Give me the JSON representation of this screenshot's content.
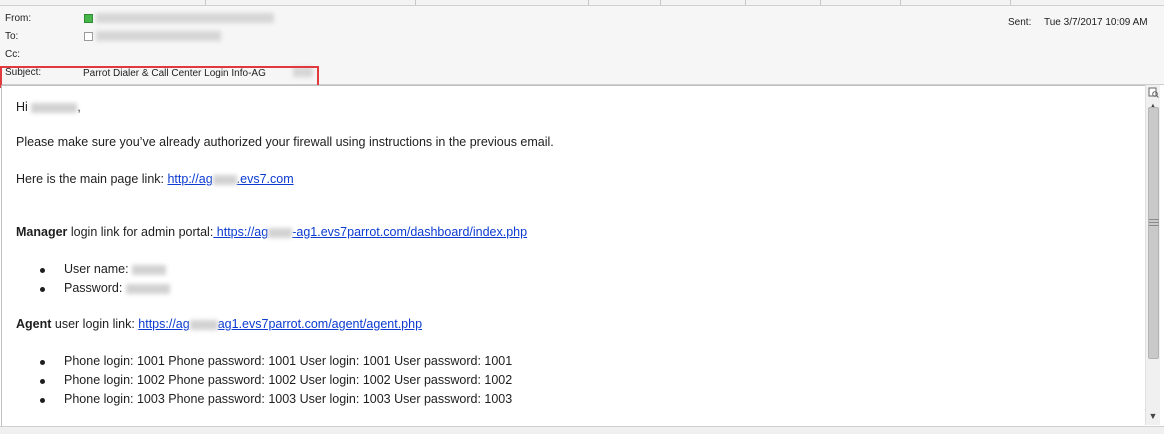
{
  "header": {
    "from_label": "From:",
    "to_label": "To:",
    "cc_label": "Cc:",
    "subject_label": "Subject:",
    "subject_value": "Parrot Dialer & Call Center Login Info-AG",
    "sent_label": "Sent:",
    "sent_value": "Tue 3/7/2017 10:09 AM"
  },
  "body": {
    "greeting": "Hi",
    "greeting_punct": ",",
    "line1": "Please make sure you’ve already authorized your firewall using instructions in the previous email.",
    "main_link_prefix": "Here is the main page link: ",
    "main_link_a": "http://ag",
    "main_link_b": ".evs7.com",
    "manager_bold": "Manager",
    "manager_rest": " login link for admin portal:",
    "manager_link_a": " https://ag",
    "manager_link_b": "-ag1.evs7parrot.com/dashboard/index.php",
    "manager_items": [
      "User name: ",
      "Password: "
    ],
    "agent_bold": "Agent",
    "agent_rest": " user login link: ",
    "agent_link_a": "https://ag",
    "agent_link_b": "ag1.evs7parrot.com/agent/agent.php",
    "phone_items": [
      "Phone login: 1001  Phone password: 1001  User login: 1001  User password: 1001",
      "Phone login: 1002  Phone password: 1002  User login: 1002  User password: 1002",
      "Phone login: 1003  Phone password: 1003  User login: 1003  User password: 1003"
    ]
  },
  "scrollbar": {
    "up_arrow": "▲",
    "down_arrow": "▼",
    "scroll_position": 0.0
  },
  "colors": {
    "link": "#0b3bd1",
    "highlight_box": "#e0393e",
    "presence_available": "#46b64a"
  }
}
